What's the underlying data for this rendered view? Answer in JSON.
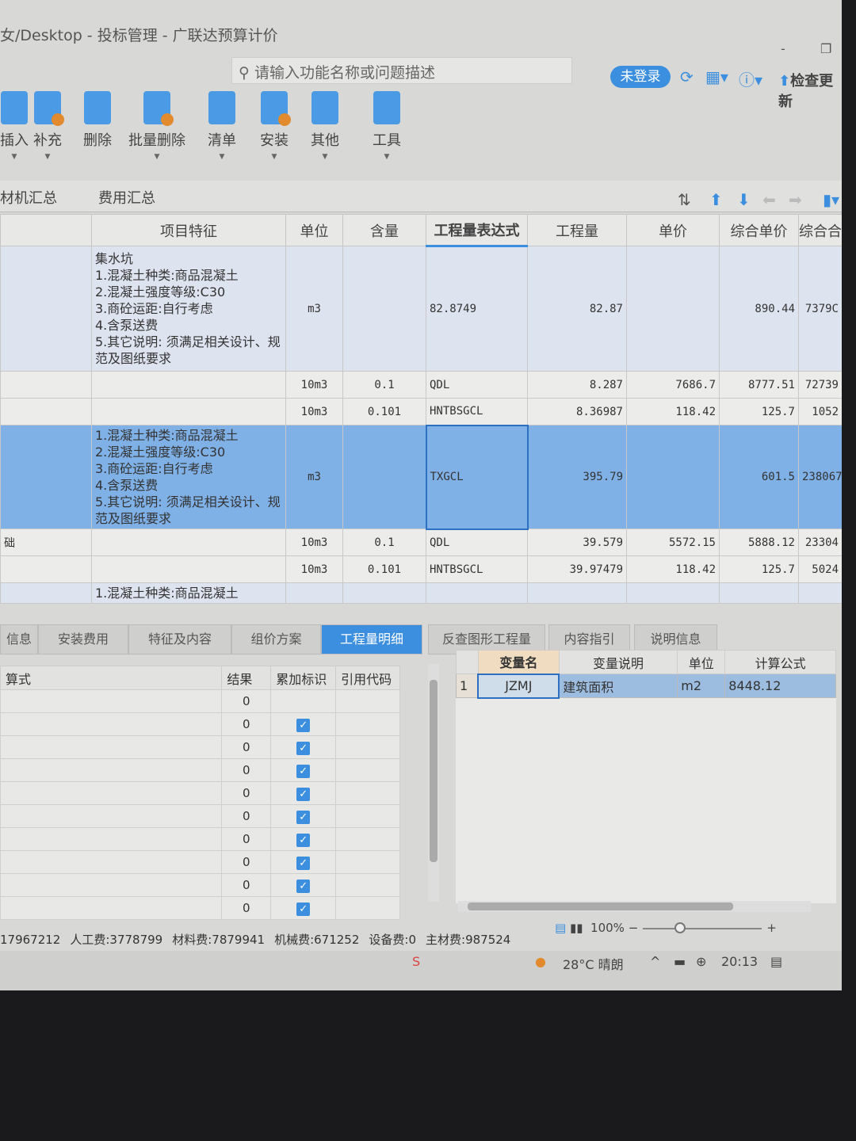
{
  "window": {
    "title": "女/Desktop - 投标管理 - 广联达预算计价",
    "minimize": "-",
    "restore": "❐"
  },
  "search": {
    "placeholder": "请输入功能名称或问题描述"
  },
  "header": {
    "login": "未登录",
    "update": "检查更新"
  },
  "toolbar": [
    {
      "label": "插入",
      "dd": "▼"
    },
    {
      "label": "补充",
      "dd": "▼"
    },
    {
      "label": "删除",
      "dd": ""
    },
    {
      "label": "批量删除",
      "dd": "▼"
    },
    {
      "label": "清单",
      "dd": "▼"
    },
    {
      "label": "安装",
      "dd": "▼"
    },
    {
      "label": "其他",
      "dd": "▼"
    },
    {
      "label": "工具",
      "dd": "▼"
    }
  ],
  "subtabs": [
    "材机汇总",
    "费用汇总"
  ],
  "grid": {
    "columns": [
      "",
      "项目特征",
      "单位",
      "含量",
      "工程量表达式",
      "工程量",
      "单价",
      "综合单价",
      "综合合"
    ],
    "rows": [
      {
        "type": "main",
        "cells": [
          "",
          "集水坑\n1.混凝土种类:商品混凝土\n2.混凝土强度等级:C30\n3.商砼运距:自行考虑\n4.含泵送费\n5.其它说明: 须满足相关设计、规范及图纸要求",
          "m3",
          "",
          "82.8749",
          "82.87",
          "",
          "890.44",
          "7379C"
        ]
      },
      {
        "type": "sub",
        "cells": [
          "",
          "",
          "10m3",
          "0.1",
          "QDL",
          "8.287",
          "7686.7",
          "8777.51",
          "72739"
        ]
      },
      {
        "type": "sub",
        "cells": [
          "",
          "",
          "10m3",
          "0.101",
          "HNTBSGCL",
          "8.36987",
          "118.42",
          "125.7",
          "1052"
        ]
      },
      {
        "type": "sel",
        "cells": [
          "",
          "1.混凝土种类:商品混凝土\n2.混凝土强度等级:C30\n3.商砼运距:自行考虑\n4.含泵送费\n5.其它说明: 须满足相关设计、规范及图纸要求",
          "m3",
          "",
          "TXGCL",
          "395.79",
          "",
          "601.5",
          "238067"
        ]
      },
      {
        "type": "sub",
        "cells": [
          "础",
          "",
          "10m3",
          "0.1",
          "QDL",
          "39.579",
          "5572.15",
          "5888.12",
          "23304"
        ]
      },
      {
        "type": "sub",
        "cells": [
          "",
          "",
          "10m3",
          "0.101",
          "HNTBSGCL",
          "39.97479",
          "118.42",
          "125.7",
          "5024"
        ]
      },
      {
        "type": "main",
        "cells": [
          "",
          "1.混凝土种类:商品混凝土",
          "",
          "",
          "",
          "",
          "",
          "",
          ""
        ]
      }
    ]
  },
  "bottom_tabs": [
    "信息",
    "安装费用",
    "特征及内容",
    "组价方案",
    "工程量明细",
    "反查图形工程量",
    "内容指引",
    "说明信息"
  ],
  "detail": {
    "columns": [
      "算式",
      "结果",
      "累加标识",
      "引用代码"
    ],
    "results": [
      "0",
      "0",
      "0",
      "0",
      "0",
      "0",
      "0",
      "0",
      "0",
      "0"
    ],
    "checked": [
      false,
      true,
      true,
      true,
      true,
      true,
      true,
      true,
      true,
      true
    ]
  },
  "variables": {
    "columns": [
      "变量名",
      "变量说明",
      "单位",
      "计算公式"
    ],
    "rows": [
      {
        "index": "1",
        "name": "JZMJ",
        "desc": "建筑面积",
        "unit": "m2",
        "formula": "8448.12"
      }
    ]
  },
  "status": {
    "items": [
      "17967212",
      "人工费:3778799",
      "材料费:7879941",
      "机械费:671252",
      "设备费:0",
      "主材费:987524"
    ],
    "zoom": "100%"
  },
  "taskbar": {
    "weather": "28°C 晴朗",
    "time": "20:13"
  },
  "colors": {
    "accent": "#3b8fde",
    "selected_row": "#7fb0e6"
  }
}
